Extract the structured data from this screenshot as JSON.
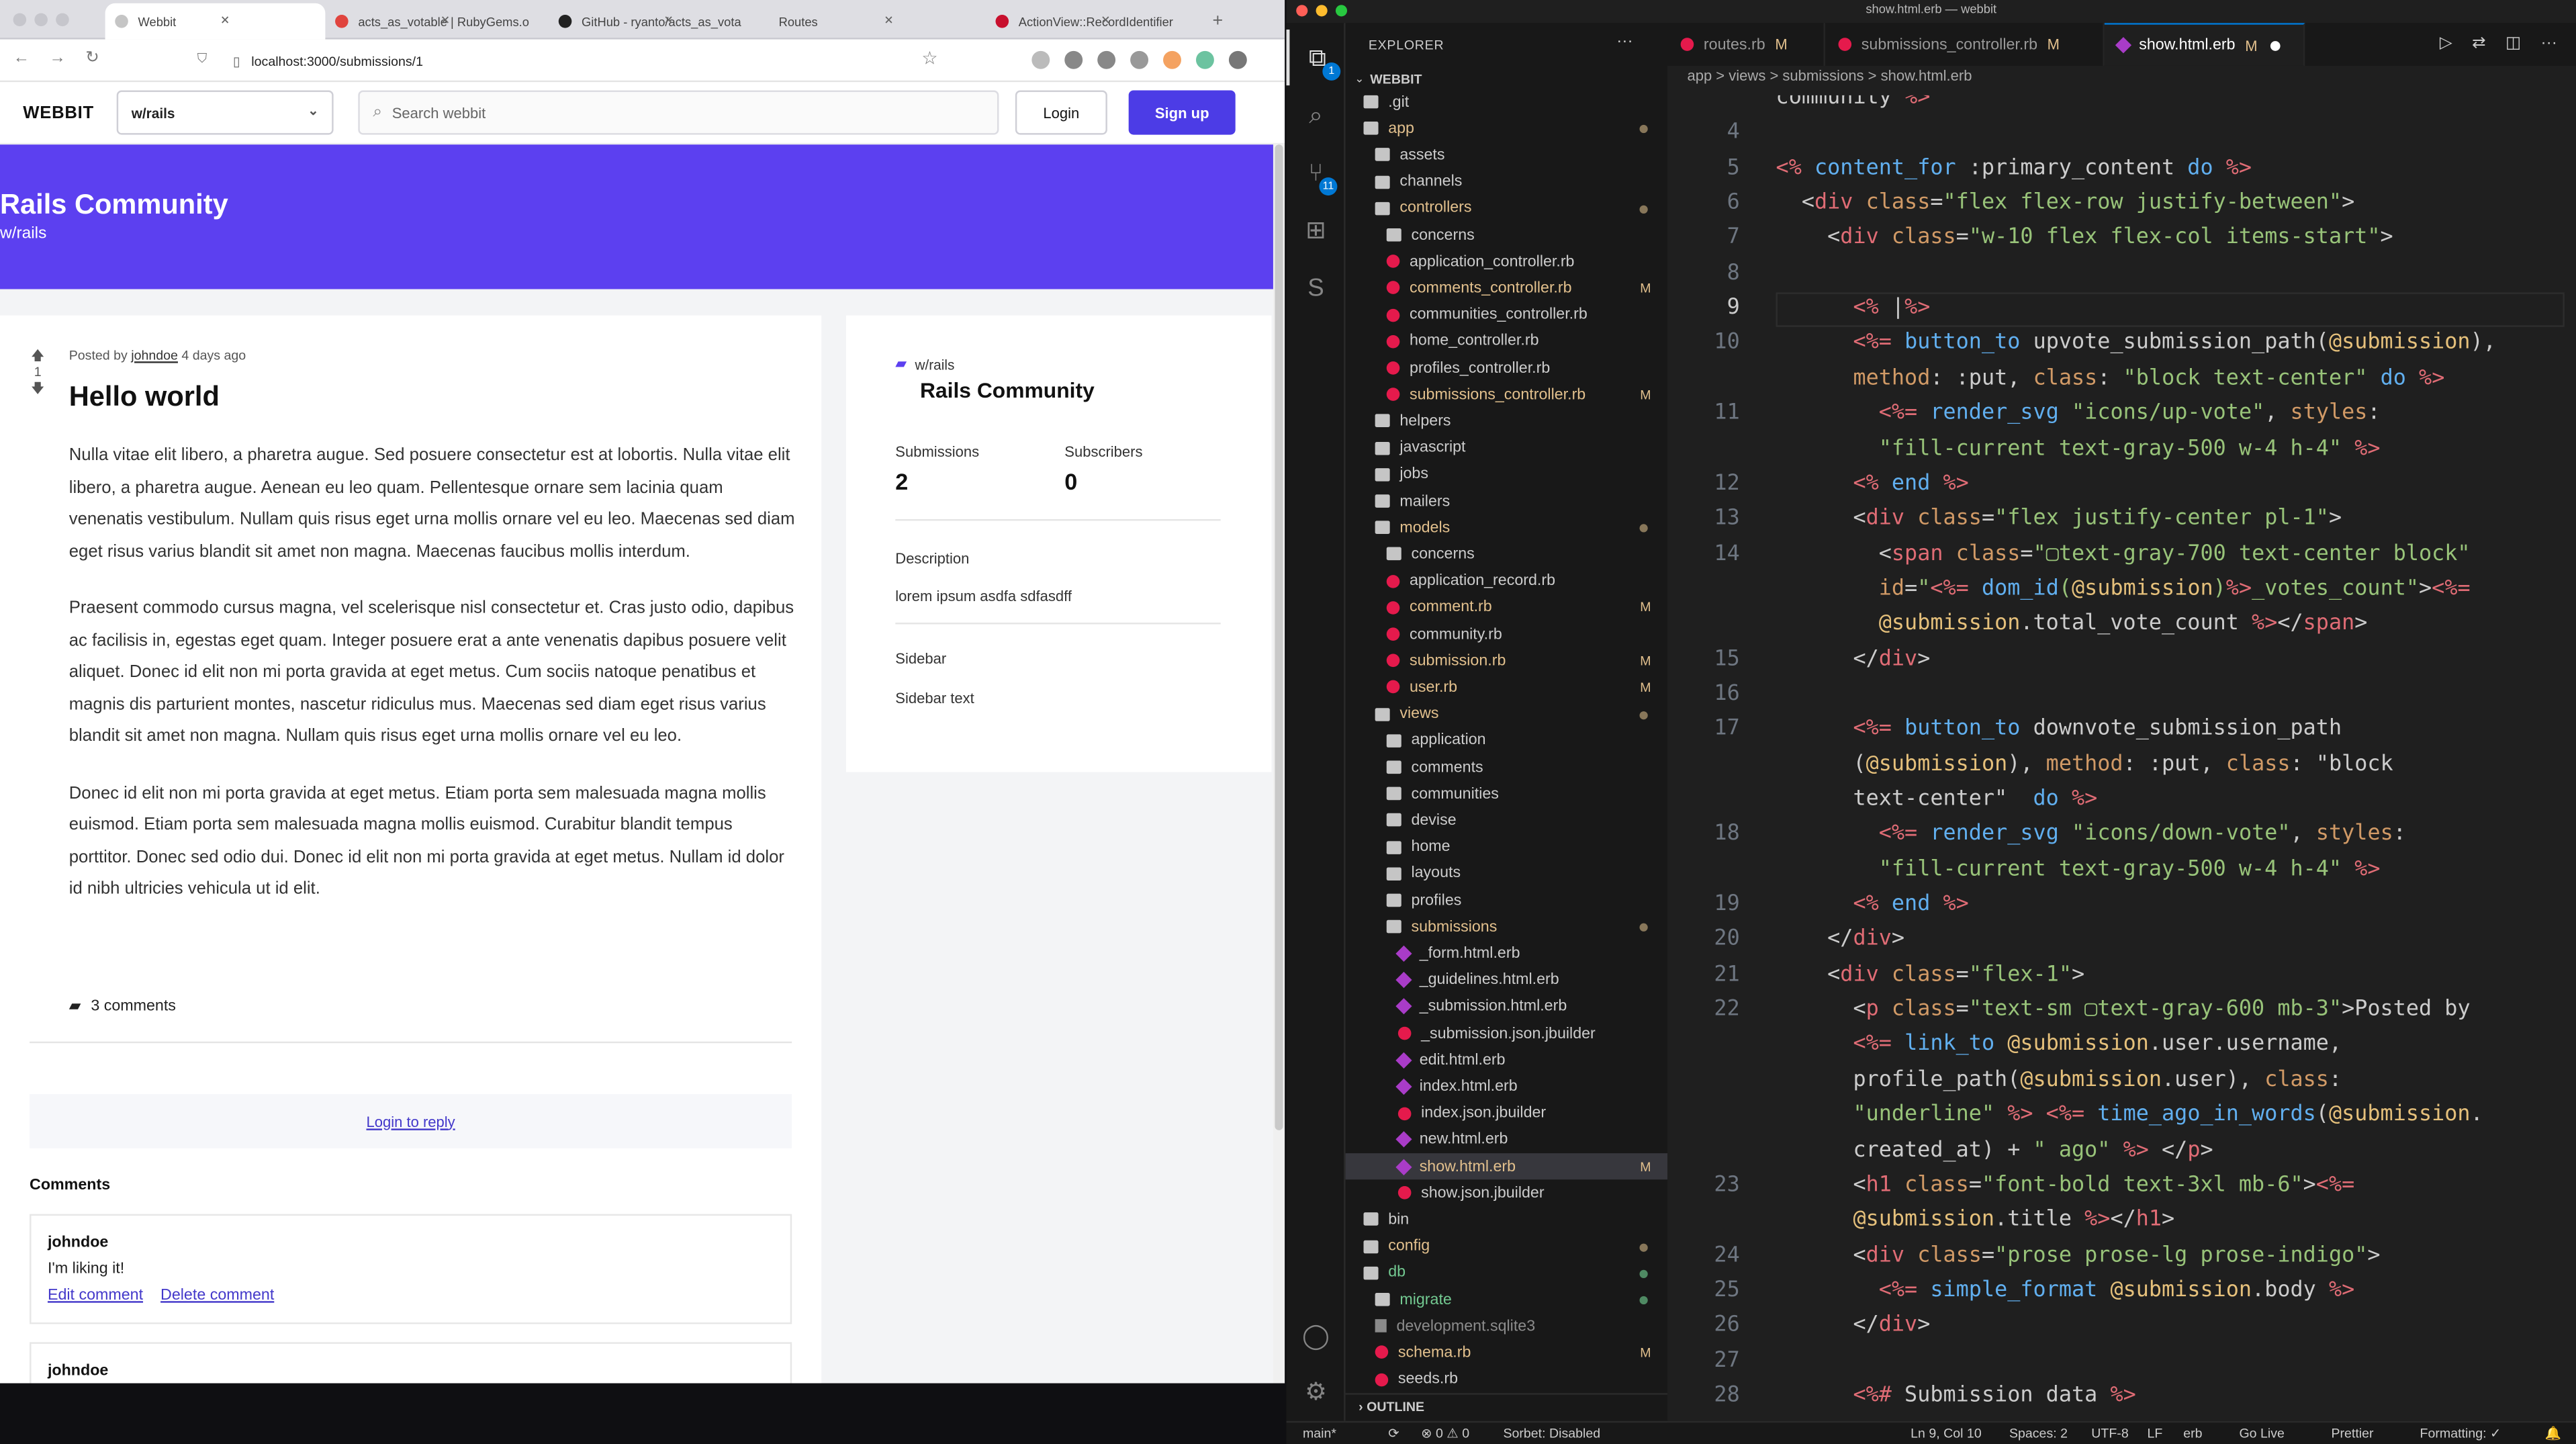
{
  "browser": {
    "tabs": [
      {
        "title": "Webbit",
        "active": true,
        "icon_color": "#c5c5c5"
      },
      {
        "title": "acts_as_votable | RubyGems.o",
        "active": false,
        "icon_color": "#e0443e"
      },
      {
        "title": "GitHub - ryanto/acts_as_vota",
        "active": false,
        "icon_color": "#222222"
      },
      {
        "title": "Routes",
        "active": false,
        "icon_color": ""
      },
      {
        "title": "ActionView::RecordIdentifier",
        "active": false,
        "icon_color": "#c8102e"
      }
    ],
    "new_tab": "+",
    "url": "localhost:3000/submissions/1",
    "extension_colors": [
      "#bbbbbb",
      "#888888",
      "#888888",
      "#999999",
      "#f4a261",
      "#6cc3a0",
      "#777777"
    ]
  },
  "site": {
    "logo": "WEBBIT",
    "community_select": "w/rails",
    "search_placeholder": "Search webbit",
    "login_label": "Login",
    "signup_label": "Sign up",
    "accent": "#5c40f0"
  },
  "banner": {
    "title": "Rails Community",
    "subtitle": "w/rails"
  },
  "post": {
    "vote_count": "1",
    "posted_by_prefix": "Posted by",
    "author": "johndoe",
    "time_ago": "4 days ago",
    "title": "Hello world",
    "paragraphs": [
      "Nulla vitae elit libero, a pharetra augue. Sed posuere consectetur est at lobortis. Nulla vitae elit libero, a pharetra augue. Aenean eu leo quam. Pellentesque ornare sem lacinia quam venenatis vestibulum. Nullam quis risus eget urna mollis ornare vel eu leo. Maecenas sed diam eget risus varius blandit sit amet non magna. Maecenas faucibus mollis interdum.",
      "Praesent commodo cursus magna, vel scelerisque nisl consectetur et. Cras justo odio, dapibus ac facilisis in, egestas eget quam. Integer posuere erat a ante venenatis dapibus posuere velit aliquet. Donec id elit non mi porta gravida at eget metus. Cum sociis natoque penatibus et magnis dis parturient montes, nascetur ridiculus mus. Maecenas sed diam eget risus varius blandit sit amet non magna. Nullam quis risus eget urna mollis ornare vel eu leo.",
      "Donec id elit non mi porta gravida at eget metus. Etiam porta sem malesuada magna mollis euismod. Etiam porta sem malesuada magna mollis euismod. Curabitur blandit tempus porttitor. Donec sed odio dui. Donec id elit non mi porta gravida at eget metus. Nullam id dolor id nibh ultricies vehicula ut id elit."
    ],
    "comments_count": "3 comments",
    "login_to_reply": "Login to reply",
    "comments_heading": "Comments",
    "comments": [
      {
        "author": "johndoe",
        "body": "I'm liking it!",
        "edit": "Edit comment",
        "delete": "Delete comment"
      },
      {
        "author": "johndoe",
        "body": "",
        "edit": "",
        "delete": ""
      }
    ]
  },
  "sidebar": {
    "community_short": "w/rails",
    "community_name": "Rails Community",
    "submissions_label": "Submissions",
    "submissions_count": "2",
    "subscribers_label": "Subscribers",
    "subscribers_count": "0",
    "description_label": "Description",
    "description_text": "lorem ipsum asdfa sdfasdff",
    "sidebar_label": "Sidebar",
    "sidebar_text": "Sidebar text"
  },
  "vscode": {
    "window_title": "show.html.erb — webbit",
    "activity": [
      {
        "name": "files-icon",
        "glyph": "⧉",
        "active": true,
        "badge": "1"
      },
      {
        "name": "search-icon",
        "glyph": "⌕",
        "active": false,
        "badge": ""
      },
      {
        "name": "source-control-icon",
        "glyph": "⑂",
        "active": false,
        "badge": "11"
      },
      {
        "name": "extensions-icon",
        "glyph": "⊞",
        "active": false,
        "badge": ""
      },
      {
        "name": "sorbet-icon",
        "glyph": "S",
        "active": false,
        "badge": ""
      }
    ],
    "explorer_title": "EXPLORER",
    "explorer_more": "···",
    "root": "WEBBIT",
    "tree": [
      {
        "label": ".git",
        "kind": "folder",
        "depth": 1,
        "status": "",
        "arrow": ""
      },
      {
        "label": "app",
        "kind": "folder",
        "depth": 1,
        "status": "dot",
        "arrow": "⌄",
        "color": "mod"
      },
      {
        "label": "assets",
        "kind": "folder",
        "depth": 2,
        "status": "",
        "arrow": ""
      },
      {
        "label": "channels",
        "kind": "folder",
        "depth": 2,
        "status": "",
        "arrow": ""
      },
      {
        "label": "controllers",
        "kind": "folder",
        "depth": 2,
        "status": "dot",
        "arrow": "⌄",
        "color": "mod"
      },
      {
        "label": "concerns",
        "kind": "folder",
        "depth": 3,
        "status": "",
        "arrow": ""
      },
      {
        "label": "application_controller.rb",
        "kind": "rb",
        "depth": 3,
        "status": "",
        "arrow": ""
      },
      {
        "label": "comments_controller.rb",
        "kind": "rb",
        "depth": 3,
        "status": "M",
        "arrow": "",
        "color": "mod"
      },
      {
        "label": "communities_controller.rb",
        "kind": "rb",
        "depth": 3,
        "status": "",
        "arrow": ""
      },
      {
        "label": "home_controller.rb",
        "kind": "rb",
        "depth": 3,
        "status": "",
        "arrow": ""
      },
      {
        "label": "profiles_controller.rb",
        "kind": "rb",
        "depth": 3,
        "status": "",
        "arrow": ""
      },
      {
        "label": "submissions_controller.rb",
        "kind": "rb",
        "depth": 3,
        "status": "M",
        "arrow": "",
        "color": "mod"
      },
      {
        "label": "helpers",
        "kind": "folder",
        "depth": 2,
        "status": "",
        "arrow": ""
      },
      {
        "label": "javascript",
        "kind": "folder",
        "depth": 2,
        "status": "",
        "arrow": ""
      },
      {
        "label": "jobs",
        "kind": "folder",
        "depth": 2,
        "status": "",
        "arrow": ""
      },
      {
        "label": "mailers",
        "kind": "folder",
        "depth": 2,
        "status": "",
        "arrow": ""
      },
      {
        "label": "models",
        "kind": "folder",
        "depth": 2,
        "status": "dot",
        "arrow": "⌄",
        "color": "mod"
      },
      {
        "label": "concerns",
        "kind": "folder",
        "depth": 3,
        "status": "",
        "arrow": ""
      },
      {
        "label": "application_record.rb",
        "kind": "rb",
        "depth": 3,
        "status": "",
        "arrow": ""
      },
      {
        "label": "comment.rb",
        "kind": "rb",
        "depth": 3,
        "status": "M",
        "arrow": "",
        "color": "mod"
      },
      {
        "label": "community.rb",
        "kind": "rb",
        "depth": 3,
        "status": "",
        "arrow": ""
      },
      {
        "label": "submission.rb",
        "kind": "rb",
        "depth": 3,
        "status": "M",
        "arrow": "",
        "color": "mod"
      },
      {
        "label": "user.rb",
        "kind": "rb",
        "depth": 3,
        "status": "M",
        "arrow": "",
        "color": "mod"
      },
      {
        "label": "views",
        "kind": "folder",
        "depth": 2,
        "status": "dot",
        "arrow": "⌄",
        "color": "mod"
      },
      {
        "label": "application",
        "kind": "folder",
        "depth": 3,
        "status": "",
        "arrow": ""
      },
      {
        "label": "comments",
        "kind": "folder",
        "depth": 3,
        "status": "",
        "arrow": ""
      },
      {
        "label": "communities",
        "kind": "folder",
        "depth": 3,
        "status": "",
        "arrow": ""
      },
      {
        "label": "devise",
        "kind": "folder",
        "depth": 3,
        "status": "",
        "arrow": ""
      },
      {
        "label": "home",
        "kind": "folder",
        "depth": 3,
        "status": "",
        "arrow": ""
      },
      {
        "label": "layouts",
        "kind": "folder",
        "depth": 3,
        "status": "",
        "arrow": ""
      },
      {
        "label": "profiles",
        "kind": "folder",
        "depth": 3,
        "status": "",
        "arrow": ""
      },
      {
        "label": "submissions",
        "kind": "folder",
        "depth": 3,
        "status": "dot",
        "arrow": "⌄",
        "color": "mod"
      },
      {
        "label": "_form.html.erb",
        "kind": "erb",
        "depth": 4,
        "status": "",
        "arrow": ""
      },
      {
        "label": "_guidelines.html.erb",
        "kind": "erb",
        "depth": 4,
        "status": "",
        "arrow": ""
      },
      {
        "label": "_submission.html.erb",
        "kind": "erb",
        "depth": 4,
        "status": "",
        "arrow": ""
      },
      {
        "label": "_submission.json.jbuilder",
        "kind": "rb",
        "depth": 4,
        "status": "",
        "arrow": ""
      },
      {
        "label": "edit.html.erb",
        "kind": "erb",
        "depth": 4,
        "status": "",
        "arrow": ""
      },
      {
        "label": "index.html.erb",
        "kind": "erb",
        "depth": 4,
        "status": "",
        "arrow": ""
      },
      {
        "label": "index.json.jbuilder",
        "kind": "rb",
        "depth": 4,
        "status": "",
        "arrow": ""
      },
      {
        "label": "new.html.erb",
        "kind": "erb",
        "depth": 4,
        "status": "",
        "arrow": ""
      },
      {
        "label": "show.html.erb",
        "kind": "erb",
        "depth": 4,
        "status": "M",
        "arrow": "",
        "color": "mod",
        "selected": true
      },
      {
        "label": "show.json.jbuilder",
        "kind": "rb",
        "depth": 4,
        "status": "",
        "arrow": ""
      },
      {
        "label": "bin",
        "kind": "folder",
        "depth": 1,
        "status": "",
        "arrow": ""
      },
      {
        "label": "config",
        "kind": "folder",
        "depth": 1,
        "status": "dot",
        "arrow": "",
        "color": "mod"
      },
      {
        "label": "db",
        "kind": "folder",
        "depth": 1,
        "status": "dot-green",
        "arrow": "⌄",
        "color": "git"
      },
      {
        "label": "migrate",
        "kind": "folder",
        "depth": 2,
        "status": "dot-green",
        "arrow": "",
        "color": "git"
      },
      {
        "label": "development.sqlite3",
        "kind": "db",
        "depth": 2,
        "status": "",
        "arrow": "",
        "color": "ign"
      },
      {
        "label": "schema.rb",
        "kind": "rb",
        "depth": 2,
        "status": "M",
        "arrow": "",
        "color": "mod"
      },
      {
        "label": "seeds.rb",
        "kind": "rb",
        "depth": 2,
        "status": "",
        "arrow": ""
      }
    ],
    "outline_label": "OUTLINE",
    "tabs": [
      {
        "label": "routes.rb",
        "kind": "rb",
        "status": "M",
        "active": false
      },
      {
        "label": "submissions_controller.rb",
        "kind": "rb",
        "status": "M",
        "active": false
      },
      {
        "label": "show.html.erb",
        "kind": "erb",
        "status": "M",
        "active": true
      }
    ],
    "breadcrumbs": "app > views > submissions > show.html.erb",
    "code_lines": [
      {
        "n": "",
        "text": "community %>"
      },
      {
        "n": "4",
        "text": ""
      },
      {
        "n": "5",
        "text": "<% content_for :primary_content do %>"
      },
      {
        "n": "6",
        "text": "  <div class=\"flex flex-row justify-between\">"
      },
      {
        "n": "7",
        "text": "    <div class=\"w-10 flex flex-col items-start\">"
      },
      {
        "n": "8",
        "text": ""
      },
      {
        "n": "9",
        "text": "      <% |%>",
        "current": true
      },
      {
        "n": "10",
        "text": "      <%= button_to upvote_submission_path(@submission),"
      },
      {
        "n": "",
        "text": "      method: :put, class: \"block text-center\" do %>"
      },
      {
        "n": "11",
        "text": "        <%= render_svg \"icons/up-vote\", styles:"
      },
      {
        "n": "",
        "text": "        \"fill-current text-gray-500 w-4 h-4\" %>"
      },
      {
        "n": "12",
        "text": "      <% end %>"
      },
      {
        "n": "13",
        "text": "      <div class=\"flex justify-center pl-1\">"
      },
      {
        "n": "14",
        "text": "        <span class=\"▢text-gray-700 text-center block\""
      },
      {
        "n": "",
        "text": "        id=\"<%= dom_id(@submission)%>_votes_count\"><%="
      },
      {
        "n": "",
        "text": "        @submission.total_vote_count %></span>"
      },
      {
        "n": "15",
        "text": "      </div>"
      },
      {
        "n": "16",
        "text": ""
      },
      {
        "n": "17",
        "text": "      <%= button_to downvote_submission_path"
      },
      {
        "n": "",
        "text": "      (@submission), method: :put, class: \"block"
      },
      {
        "n": "",
        "text": "      text-center\"  do %>"
      },
      {
        "n": "18",
        "text": "        <%= render_svg \"icons/down-vote\", styles:"
      },
      {
        "n": "",
        "text": "        \"fill-current text-gray-500 w-4 h-4\" %>"
      },
      {
        "n": "19",
        "text": "      <% end %>"
      },
      {
        "n": "20",
        "text": "    </div>"
      },
      {
        "n": "21",
        "text": "    <div class=\"flex-1\">"
      },
      {
        "n": "22",
        "text": "      <p class=\"text-sm ▢text-gray-600 mb-3\">Posted by"
      },
      {
        "n": "",
        "text": "      <%= link_to @submission.user.username,"
      },
      {
        "n": "",
        "text": "      profile_path(@submission.user), class:"
      },
      {
        "n": "",
        "text": "      \"underline\" %> <%= time_ago_in_words(@submission."
      },
      {
        "n": "",
        "text": "      created_at) + \" ago\" %> </p>"
      },
      {
        "n": "23",
        "text": "      <h1 class=\"font-bold text-3xl mb-6\"><%="
      },
      {
        "n": "",
        "text": "      @submission.title %></h1>"
      },
      {
        "n": "24",
        "text": "      <div class=\"prose prose-lg prose-indigo\">"
      },
      {
        "n": "25",
        "text": "        <%= simple_format @submission.body %>"
      },
      {
        "n": "26",
        "text": "      </div>"
      },
      {
        "n": "27",
        "text": ""
      },
      {
        "n": "28",
        "text": "      <%# Submission data %>"
      }
    ],
    "status": {
      "branch": "main*",
      "errors": "⊗ 0 ⚠ 0",
      "sorbet": "Sorbet: Disabled",
      "position": "Ln 9, Col 10",
      "spaces": "Spaces: 2",
      "encoding": "UTF-8",
      "eol": "LF",
      "language": "erb",
      "golive": "Go Live",
      "prettier": "Prettier",
      "formatting": "Formatting: ✓"
    }
  }
}
